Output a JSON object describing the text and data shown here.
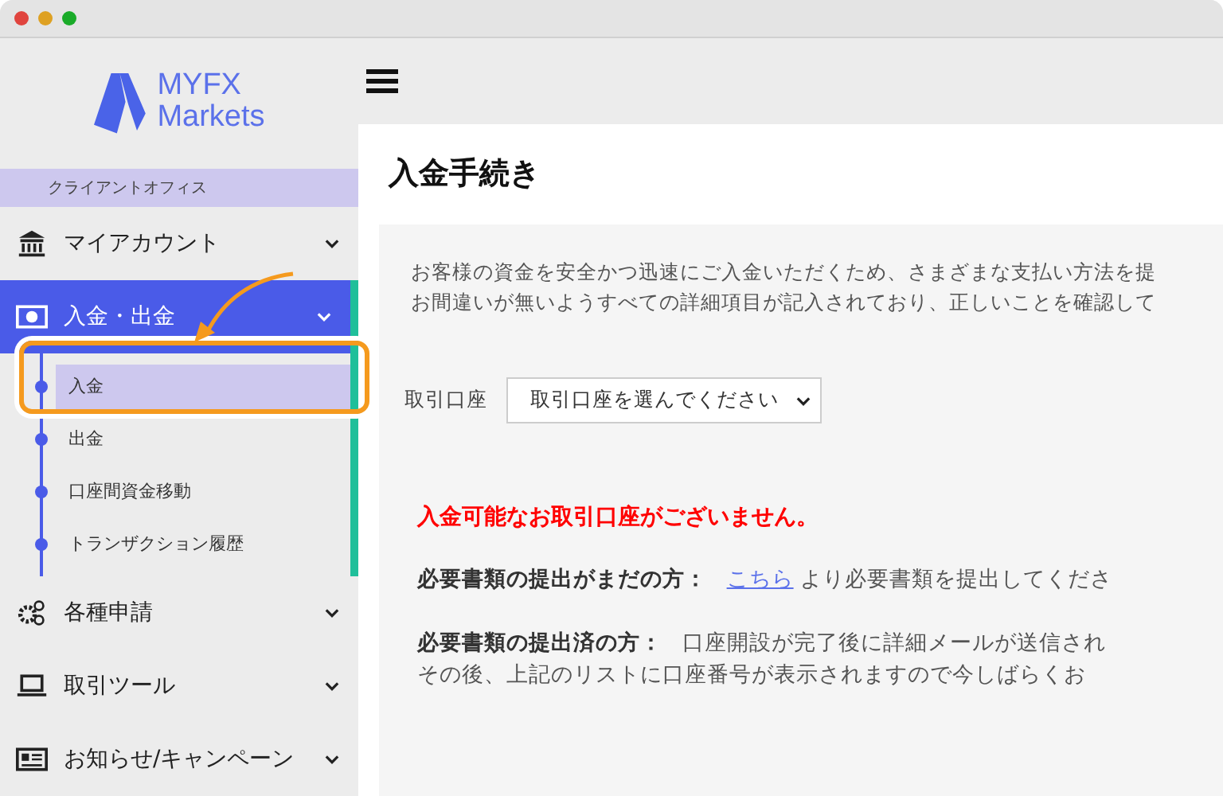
{
  "logo": {
    "line1": "MYFX",
    "line2": "Markets"
  },
  "sidebar": {
    "section_label": "クライアントオフィス",
    "items": [
      {
        "label": "マイアカウント",
        "selected": false
      },
      {
        "label": "入金・出金",
        "selected": true,
        "children": [
          {
            "label": "入金",
            "selected": true
          },
          {
            "label": "出金",
            "selected": false
          },
          {
            "label": "口座間資金移動",
            "selected": false
          },
          {
            "label": "トランザクション履歴",
            "selected": false
          }
        ]
      },
      {
        "label": "各種申請",
        "selected": false
      },
      {
        "label": "取引ツール",
        "selected": false
      },
      {
        "label": "お知らせ/キャンペーン",
        "selected": false
      }
    ]
  },
  "page": {
    "title": "入金手続き",
    "intro": [
      "お客様の資金を安全かつ迅速にご入金いただくため、さまざまな支払い方法を提",
      "お間違いが無いようすべての詳細項目が記入されており、正しいことを確認して"
    ],
    "account_label": "取引口座",
    "account_select": "取引口座を選んでください",
    "warning": "入金可能なお取引口座がございません。",
    "notes": [
      {
        "label": "必要書類の提出がまだの方：",
        "link": "こちら",
        "lines": [
          "より必要書類を提出してくださ"
        ]
      },
      {
        "label": "必要書類の提出済の方：",
        "lines": [
          "口座開設が完了後に詳細メールが送信され",
          "その後、上記のリストに口座番号が表示されますので今しばらくお"
        ]
      }
    ]
  }
}
